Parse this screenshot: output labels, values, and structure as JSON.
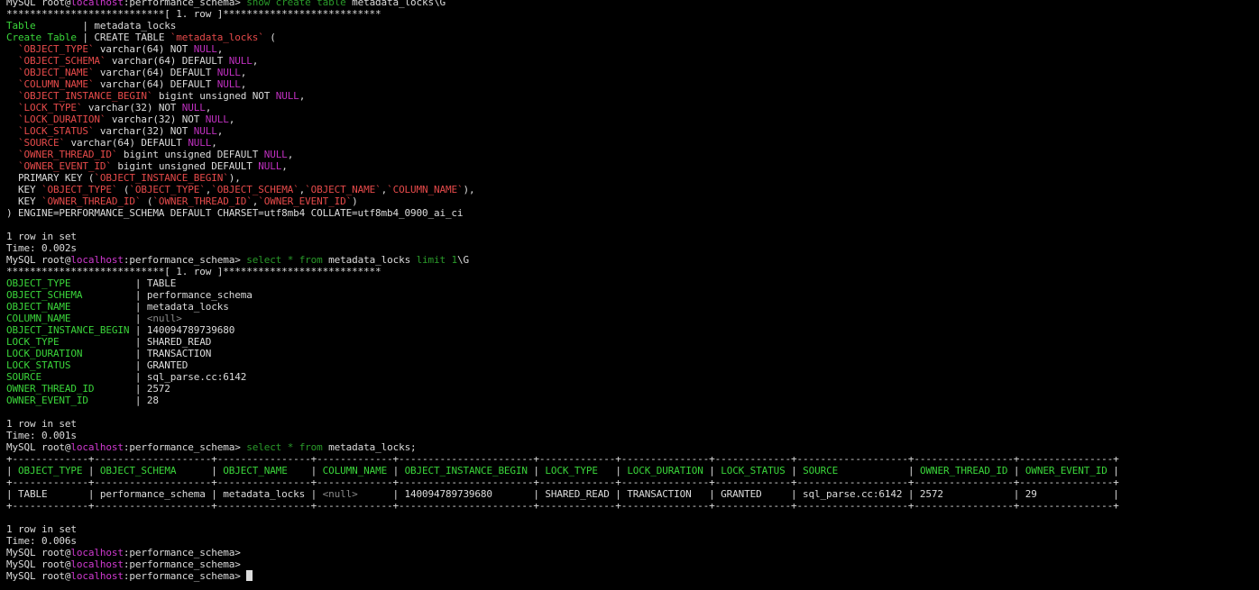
{
  "colors": {
    "default": "#dcdcdc",
    "host": "#d03ad0",
    "keyword": "#2a9a2a",
    "field": "#3ad53a",
    "string": "#e64a4a",
    "null": "#c030c0",
    "muted": "#8a8a8a",
    "cursor": "#dcdcdc",
    "background": "#000000"
  },
  "lines": [
    [
      {
        "t": "MySQL root@"
      },
      {
        "t": "localhost",
        "c": "host"
      },
      {
        "t": ":performance_schema> "
      },
      {
        "t": "show create table",
        "c": "keyword"
      },
      {
        "t": " metadata_locks\\G"
      }
    ],
    [
      {
        "t": "***************************[ 1. row ]***************************"
      }
    ],
    [
      {
        "t": "Table",
        "c": "field"
      },
      {
        "t": "        | metadata_locks"
      }
    ],
    [
      {
        "t": "Create Table",
        "c": "field"
      },
      {
        "t": " | CREATE TABLE "
      },
      {
        "t": "`metadata_locks`",
        "c": "string"
      },
      {
        "t": " ("
      }
    ],
    [
      {
        "t": "  "
      },
      {
        "t": "`OBJECT_TYPE`",
        "c": "string"
      },
      {
        "t": " varchar(64) NOT "
      },
      {
        "t": "NULL",
        "c": "null"
      },
      {
        "t": ","
      }
    ],
    [
      {
        "t": "  "
      },
      {
        "t": "`OBJECT_SCHEMA`",
        "c": "string"
      },
      {
        "t": " varchar(64) DEFAULT "
      },
      {
        "t": "NULL",
        "c": "null"
      },
      {
        "t": ","
      }
    ],
    [
      {
        "t": "  "
      },
      {
        "t": "`OBJECT_NAME`",
        "c": "string"
      },
      {
        "t": " varchar(64) DEFAULT "
      },
      {
        "t": "NULL",
        "c": "null"
      },
      {
        "t": ","
      }
    ],
    [
      {
        "t": "  "
      },
      {
        "t": "`COLUMN_NAME`",
        "c": "string"
      },
      {
        "t": " varchar(64) DEFAULT "
      },
      {
        "t": "NULL",
        "c": "null"
      },
      {
        "t": ","
      }
    ],
    [
      {
        "t": "  "
      },
      {
        "t": "`OBJECT_INSTANCE_BEGIN`",
        "c": "string"
      },
      {
        "t": " bigint unsigned NOT "
      },
      {
        "t": "NULL",
        "c": "null"
      },
      {
        "t": ","
      }
    ],
    [
      {
        "t": "  "
      },
      {
        "t": "`LOCK_TYPE`",
        "c": "string"
      },
      {
        "t": " varchar(32) NOT "
      },
      {
        "t": "NULL",
        "c": "null"
      },
      {
        "t": ","
      }
    ],
    [
      {
        "t": "  "
      },
      {
        "t": "`LOCK_DURATION`",
        "c": "string"
      },
      {
        "t": " varchar(32) NOT "
      },
      {
        "t": "NULL",
        "c": "null"
      },
      {
        "t": ","
      }
    ],
    [
      {
        "t": "  "
      },
      {
        "t": "`LOCK_STATUS`",
        "c": "string"
      },
      {
        "t": " varchar(32) NOT "
      },
      {
        "t": "NULL",
        "c": "null"
      },
      {
        "t": ","
      }
    ],
    [
      {
        "t": "  "
      },
      {
        "t": "`SOURCE`",
        "c": "string"
      },
      {
        "t": " varchar(64) DEFAULT "
      },
      {
        "t": "NULL",
        "c": "null"
      },
      {
        "t": ","
      }
    ],
    [
      {
        "t": "  "
      },
      {
        "t": "`OWNER_THREAD_ID`",
        "c": "string"
      },
      {
        "t": " bigint unsigned DEFAULT "
      },
      {
        "t": "NULL",
        "c": "null"
      },
      {
        "t": ","
      }
    ],
    [
      {
        "t": "  "
      },
      {
        "t": "`OWNER_EVENT_ID`",
        "c": "string"
      },
      {
        "t": " bigint unsigned DEFAULT "
      },
      {
        "t": "NULL",
        "c": "null"
      },
      {
        "t": ","
      }
    ],
    [
      {
        "t": "  PRIMARY KEY ("
      },
      {
        "t": "`OBJECT_INSTANCE_BEGIN`",
        "c": "string"
      },
      {
        "t": "),"
      }
    ],
    [
      {
        "t": "  KEY "
      },
      {
        "t": "`OBJECT_TYPE`",
        "c": "string"
      },
      {
        "t": " ("
      },
      {
        "t": "`OBJECT_TYPE`",
        "c": "string"
      },
      {
        "t": ","
      },
      {
        "t": "`OBJECT_SCHEMA`",
        "c": "string"
      },
      {
        "t": ","
      },
      {
        "t": "`OBJECT_NAME`",
        "c": "string"
      },
      {
        "t": ","
      },
      {
        "t": "`COLUMN_NAME`",
        "c": "string"
      },
      {
        "t": "),"
      }
    ],
    [
      {
        "t": "  KEY "
      },
      {
        "t": "`OWNER_THREAD_ID`",
        "c": "string"
      },
      {
        "t": " ("
      },
      {
        "t": "`OWNER_THREAD_ID`",
        "c": "string"
      },
      {
        "t": ","
      },
      {
        "t": "`OWNER_EVENT_ID`",
        "c": "string"
      },
      {
        "t": ")"
      }
    ],
    [
      {
        "t": ") ENGINE=PERFORMANCE_SCHEMA DEFAULT CHARSET=utf8mb4 COLLATE=utf8mb4_0900_ai_ci"
      }
    ],
    [
      {
        "t": ""
      }
    ],
    [
      {
        "t": "1 row in set"
      }
    ],
    [
      {
        "t": "Time: 0.002s"
      }
    ],
    [
      {
        "t": "MySQL root@"
      },
      {
        "t": "localhost",
        "c": "host"
      },
      {
        "t": ":performance_schema> "
      },
      {
        "t": "select",
        "c": "keyword"
      },
      {
        "t": " "
      },
      {
        "t": "*",
        "c": "keyword"
      },
      {
        "t": " "
      },
      {
        "t": "from",
        "c": "keyword"
      },
      {
        "t": " metadata_locks "
      },
      {
        "t": "limit",
        "c": "keyword"
      },
      {
        "t": " "
      },
      {
        "t": "1",
        "c": "keyword"
      },
      {
        "t": "\\G"
      }
    ],
    [
      {
        "t": "***************************[ 1. row ]***************************"
      }
    ],
    [
      {
        "t": "OBJECT_TYPE",
        "c": "field"
      },
      {
        "t": "           | TABLE"
      }
    ],
    [
      {
        "t": "OBJECT_SCHEMA",
        "c": "field"
      },
      {
        "t": "         | performance_schema"
      }
    ],
    [
      {
        "t": "OBJECT_NAME",
        "c": "field"
      },
      {
        "t": "           | metadata_locks"
      }
    ],
    [
      {
        "t": "COLUMN_NAME",
        "c": "field"
      },
      {
        "t": "           | "
      },
      {
        "t": "<null>",
        "c": "muted"
      }
    ],
    [
      {
        "t": "OBJECT_INSTANCE_BEGIN",
        "c": "field"
      },
      {
        "t": " | 140094789739680"
      }
    ],
    [
      {
        "t": "LOCK_TYPE",
        "c": "field"
      },
      {
        "t": "             | SHARED_READ"
      }
    ],
    [
      {
        "t": "LOCK_DURATION",
        "c": "field"
      },
      {
        "t": "         | TRANSACTION"
      }
    ],
    [
      {
        "t": "LOCK_STATUS",
        "c": "field"
      },
      {
        "t": "           | GRANTED"
      }
    ],
    [
      {
        "t": "SOURCE",
        "c": "field"
      },
      {
        "t": "                | sql_parse.cc:6142"
      }
    ],
    [
      {
        "t": "OWNER_THREAD_ID",
        "c": "field"
      },
      {
        "t": "       | 2572"
      }
    ],
    [
      {
        "t": "OWNER_EVENT_ID",
        "c": "field"
      },
      {
        "t": "        | 28"
      }
    ],
    [
      {
        "t": ""
      }
    ],
    [
      {
        "t": "1 row in set"
      }
    ],
    [
      {
        "t": "Time: 0.001s"
      }
    ],
    [
      {
        "t": "MySQL root@"
      },
      {
        "t": "localhost",
        "c": "host"
      },
      {
        "t": ":performance_schema> "
      },
      {
        "t": "select",
        "c": "keyword"
      },
      {
        "t": " "
      },
      {
        "t": "*",
        "c": "keyword"
      },
      {
        "t": " "
      },
      {
        "t": "from",
        "c": "keyword"
      },
      {
        "t": " metadata_locks;"
      }
    ],
    [
      {
        "t": "+-------------+--------------------+----------------+-------------+-----------------------+-------------+---------------+-------------+-------------------+-----------------+----------------+"
      }
    ],
    [
      {
        "t": "| "
      },
      {
        "t": "OBJECT_TYPE",
        "c": "field"
      },
      {
        "t": " | "
      },
      {
        "t": "OBJECT_SCHEMA",
        "c": "field"
      },
      {
        "t": "      | "
      },
      {
        "t": "OBJECT_NAME",
        "c": "field"
      },
      {
        "t": "    | "
      },
      {
        "t": "COLUMN_NAME",
        "c": "field"
      },
      {
        "t": " | "
      },
      {
        "t": "OBJECT_INSTANCE_BEGIN",
        "c": "field"
      },
      {
        "t": " | "
      },
      {
        "t": "LOCK_TYPE",
        "c": "field"
      },
      {
        "t": "   | "
      },
      {
        "t": "LOCK_DURATION",
        "c": "field"
      },
      {
        "t": " | "
      },
      {
        "t": "LOCK_STATUS",
        "c": "field"
      },
      {
        "t": " | "
      },
      {
        "t": "SOURCE",
        "c": "field"
      },
      {
        "t": "            | "
      },
      {
        "t": "OWNER_THREAD_ID",
        "c": "field"
      },
      {
        "t": " | "
      },
      {
        "t": "OWNER_EVENT_ID",
        "c": "field"
      },
      {
        "t": " |"
      }
    ],
    [
      {
        "t": "+-------------+--------------------+----------------+-------------+-----------------------+-------------+---------------+-------------+-------------------+-----------------+----------------+"
      }
    ],
    [
      {
        "t": "| TABLE       | performance_schema | metadata_locks | "
      },
      {
        "t": "<null>",
        "c": "muted"
      },
      {
        "t": "      | 140094789739680       | SHARED_READ | TRANSACTION   | GRANTED     | sql_parse.cc:6142 | 2572            | 29             |"
      }
    ],
    [
      {
        "t": "+-------------+--------------------+----------------+-------------+-----------------------+-------------+---------------+-------------+-------------------+-----------------+----------------+"
      }
    ],
    [
      {
        "t": ""
      }
    ],
    [
      {
        "t": "1 row in set"
      }
    ],
    [
      {
        "t": "Time: 0.006s"
      }
    ],
    [
      {
        "t": "MySQL root@"
      },
      {
        "t": "localhost",
        "c": "host"
      },
      {
        "t": ":performance_schema>"
      }
    ],
    [
      {
        "t": "MySQL root@"
      },
      {
        "t": "localhost",
        "c": "host"
      },
      {
        "t": ":performance_schema>"
      }
    ],
    [
      {
        "t": "MySQL root@"
      },
      {
        "t": "localhost",
        "c": "host"
      },
      {
        "t": ":performance_schema> "
      },
      {
        "cursor": true
      }
    ]
  ]
}
